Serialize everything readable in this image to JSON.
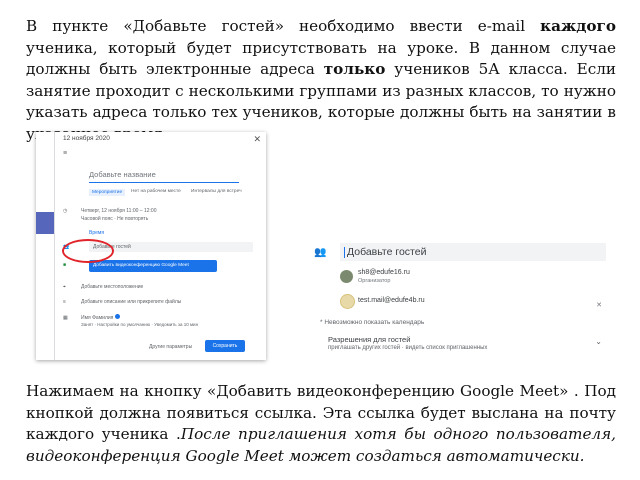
{
  "paragraph1": {
    "t1": "В пункте «Добавьте гостей» необходимо ввести e-mail ",
    "b1": "каждого",
    "t2": " ученика, который будет присутствовать на уроке. В данном случае должны быть электронные адреса ",
    "b2": "только",
    "t3": " учеников 5А класса. Если занятие проходит с несколькими группами из разных классов, то нужно указать адреса только тех учеников, которые должны быть на занятии в указанное время."
  },
  "paragraph2": {
    "t1": "Нажимаем на кнопку «Добавить видеоконференцию Google Meet» . Под кнопкой должна появиться ссылка. Эта ссылка будет выслана на почту каждого ученика .",
    "i1": "После приглашения хотя бы одного пользователя, видеоконференция Google Meet может создаться автоматически."
  },
  "calendar_dialog": {
    "date": "12 ноября 2020",
    "title_placeholder": "Добавьте название",
    "tabs": [
      "Мероприятие",
      "Нет на рабочем месте",
      "Интервалы для встреч"
    ],
    "time_line1": "Четверг, 12 ноября 11:00 – 12:00",
    "time_line2": "Часовой пояс · Не повторять",
    "find_time": "Время",
    "add_guests": "Добавьте гостей",
    "meet_button": "Добавить видеоконференцию Google Meet",
    "location": "Добавьте местоположение",
    "description": "Добавьте описание или прикрепите файлы",
    "owner_name": "Имя Фамилия",
    "owner_line": "Занят · Настройки по умолчанию · Уведомить за 10 мин",
    "more_options": "Другие параметры",
    "save": "Сохранить"
  },
  "guests_panel": {
    "placeholder": "Добавьте гостей",
    "guests": [
      {
        "email": "sh8@edufe16.ru",
        "role": "Организатор"
      },
      {
        "email": "test.mail@edufe4b.ru"
      }
    ],
    "note": "* Невозможно показать календарь",
    "permissions_title": "Разрешения для гостей",
    "permissions_sub": "приглашать других гостей · видеть список приглашенных"
  }
}
